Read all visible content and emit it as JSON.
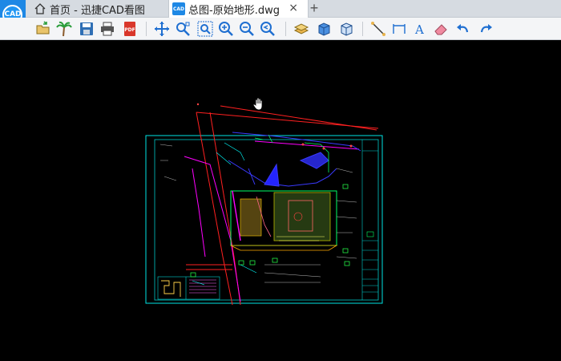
{
  "app": {
    "logo_text": "CAD"
  },
  "tabs": [
    {
      "label": "首页 - 迅捷CAD看图"
    },
    {
      "label": "总图-原始地形.dwg",
      "close_label": "×",
      "icon_text": "CAD"
    }
  ],
  "new_tab_label": "+",
  "toolbar": {
    "tools": [
      "open-icon",
      "palm-icon",
      "save-icon",
      "print-icon",
      "pdf-icon",
      "pan-icon",
      "zoom-window-icon",
      "zoom-extents-icon",
      "zoom-in-icon",
      "zoom-out-icon",
      "zoom-previous-icon",
      "layers-icon",
      "3d-view-icon",
      "3d-box-icon",
      "measure-icon",
      "dimension-icon",
      "text-icon",
      "eraser-icon",
      "undo-icon",
      "redo-icon"
    ],
    "pdf_badge": "PDF",
    "text_tool_glyph": "A"
  },
  "colors": {
    "canvas": "#000000",
    "accent": "#1e88e5",
    "frame": "#00ffff",
    "road": "#ff2020"
  }
}
